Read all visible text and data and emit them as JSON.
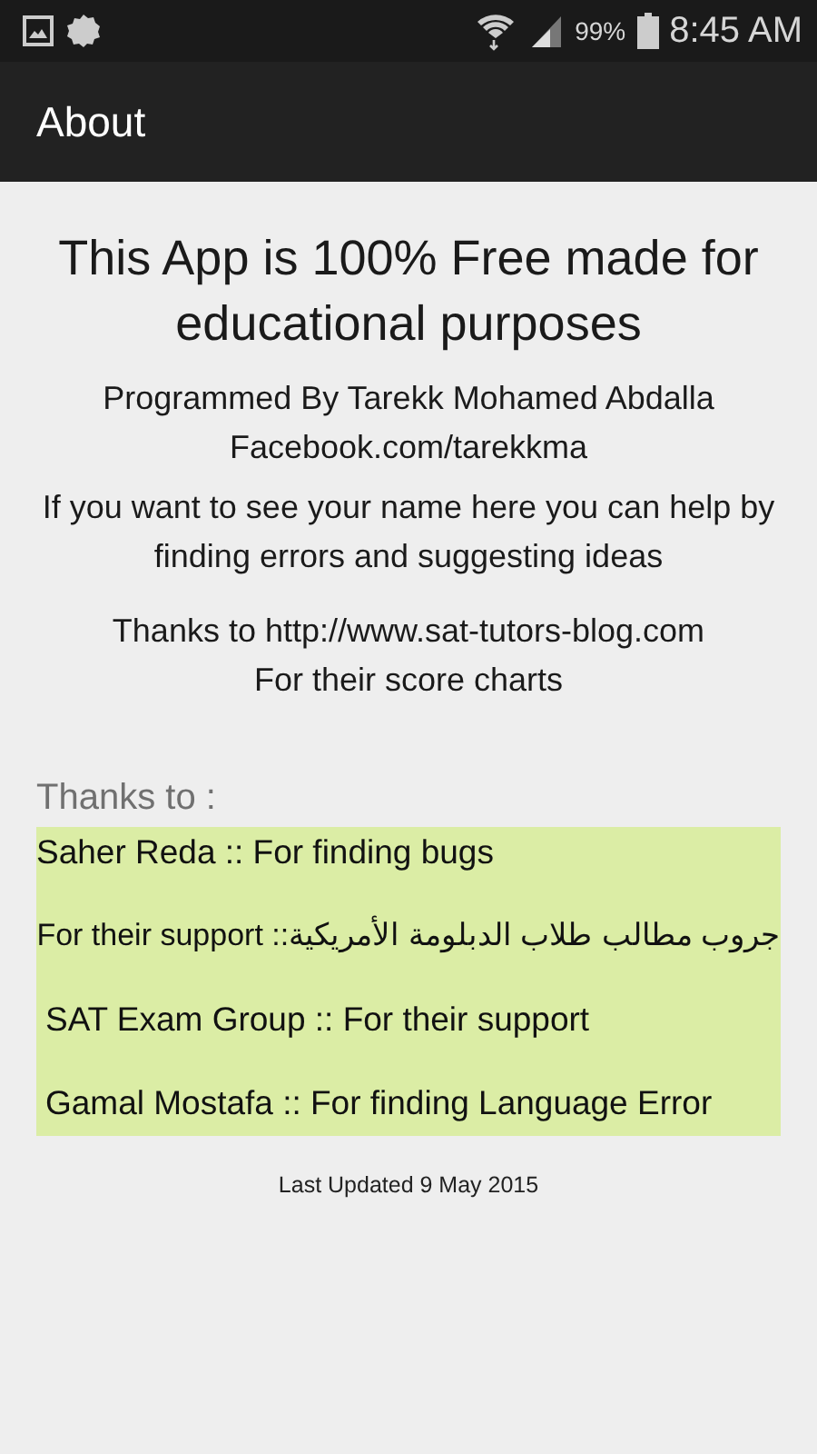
{
  "status_bar": {
    "battery": "99%",
    "time": "8:45 AM"
  },
  "app_bar": {
    "title": "About"
  },
  "headline": "This App is 100% Free made for educational purposes",
  "paragraphs": [
    {
      "lines": [
        "Programmed By Tarekk Mohamed Abdalla",
        "Facebook.com/tarekkma"
      ]
    },
    {
      "lines": [
        "If you want to see your name here you can help by finding errors and suggesting ideas"
      ]
    },
    {
      "lines": [
        "Thanks to http://www.sat-tutors-blog.com",
        "For their score charts"
      ]
    }
  ],
  "thanks_heading": "Thanks to :",
  "thanks": [
    {
      "text": "Saher Reda :: For finding bugs"
    },
    {
      "text": "جروب مطالب طلاب الدبلومة الأمريكية:: For their support"
    },
    {
      "text": "SAT Exam Group :: For their support"
    },
    {
      "text": "Gamal Mostafa :: For finding Language Error"
    }
  ],
  "footer": "Last Updated 9 May 2015"
}
